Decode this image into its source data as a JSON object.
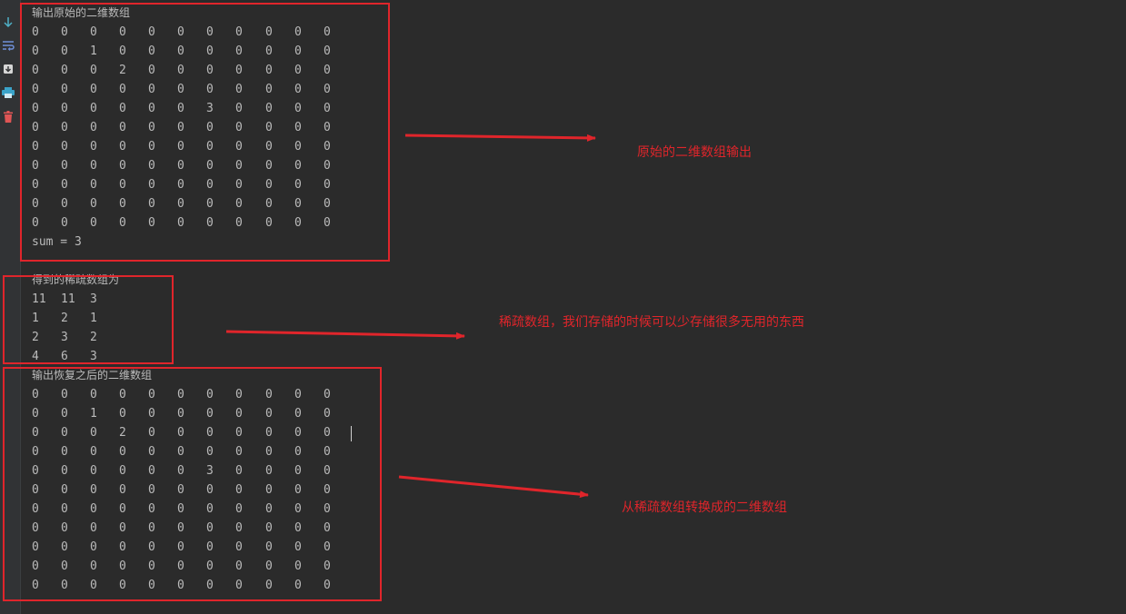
{
  "toolbar": [
    {
      "icon": "scroll-to-end-icon",
      "color": "#4fb0c6"
    },
    {
      "icon": "soft-wrap-icon",
      "color": "#6f8fd8"
    },
    {
      "icon": "import-icon",
      "color": "#d6d6d6"
    },
    {
      "icon": "print-icon",
      "color": "#3aa3c9"
    },
    {
      "icon": "trash-icon",
      "color": "#e05555"
    }
  ],
  "console": {
    "original_header": "输出原始的二维数组",
    "original": [
      [
        0,
        0,
        0,
        0,
        0,
        0,
        0,
        0,
        0,
        0,
        0
      ],
      [
        0,
        0,
        1,
        0,
        0,
        0,
        0,
        0,
        0,
        0,
        0
      ],
      [
        0,
        0,
        0,
        2,
        0,
        0,
        0,
        0,
        0,
        0,
        0
      ],
      [
        0,
        0,
        0,
        0,
        0,
        0,
        0,
        0,
        0,
        0,
        0
      ],
      [
        0,
        0,
        0,
        0,
        0,
        0,
        3,
        0,
        0,
        0,
        0
      ],
      [
        0,
        0,
        0,
        0,
        0,
        0,
        0,
        0,
        0,
        0,
        0
      ],
      [
        0,
        0,
        0,
        0,
        0,
        0,
        0,
        0,
        0,
        0,
        0
      ],
      [
        0,
        0,
        0,
        0,
        0,
        0,
        0,
        0,
        0,
        0,
        0
      ],
      [
        0,
        0,
        0,
        0,
        0,
        0,
        0,
        0,
        0,
        0,
        0
      ],
      [
        0,
        0,
        0,
        0,
        0,
        0,
        0,
        0,
        0,
        0,
        0
      ],
      [
        0,
        0,
        0,
        0,
        0,
        0,
        0,
        0,
        0,
        0,
        0
      ]
    ],
    "sum_line": "sum = 3",
    "sparse_header": "得到的稀疏数组为",
    "sparse": [
      [
        11,
        11,
        3
      ],
      [
        1,
        2,
        1
      ],
      [
        2,
        3,
        2
      ],
      [
        4,
        6,
        3
      ]
    ],
    "restored_header": "输出恢复之后的二维数组",
    "restored": [
      [
        0,
        0,
        0,
        0,
        0,
        0,
        0,
        0,
        0,
        0,
        0
      ],
      [
        0,
        0,
        1,
        0,
        0,
        0,
        0,
        0,
        0,
        0,
        0
      ],
      [
        0,
        0,
        0,
        2,
        0,
        0,
        0,
        0,
        0,
        0,
        0
      ],
      [
        0,
        0,
        0,
        0,
        0,
        0,
        0,
        0,
        0,
        0,
        0
      ],
      [
        0,
        0,
        0,
        0,
        0,
        0,
        3,
        0,
        0,
        0,
        0
      ],
      [
        0,
        0,
        0,
        0,
        0,
        0,
        0,
        0,
        0,
        0,
        0
      ],
      [
        0,
        0,
        0,
        0,
        0,
        0,
        0,
        0,
        0,
        0,
        0
      ],
      [
        0,
        0,
        0,
        0,
        0,
        0,
        0,
        0,
        0,
        0,
        0
      ],
      [
        0,
        0,
        0,
        0,
        0,
        0,
        0,
        0,
        0,
        0,
        0
      ],
      [
        0,
        0,
        0,
        0,
        0,
        0,
        0,
        0,
        0,
        0,
        0
      ],
      [
        0,
        0,
        0,
        0,
        0,
        0,
        0,
        0,
        0,
        0,
        0
      ]
    ]
  },
  "annotations": {
    "original": "原始的二维数组输出",
    "sparse": "稀疏数组，我们存储的时候可以少存储很多无用的东西",
    "restored": "从稀疏数组转换成的二维数组",
    "color": "#e0252b"
  }
}
